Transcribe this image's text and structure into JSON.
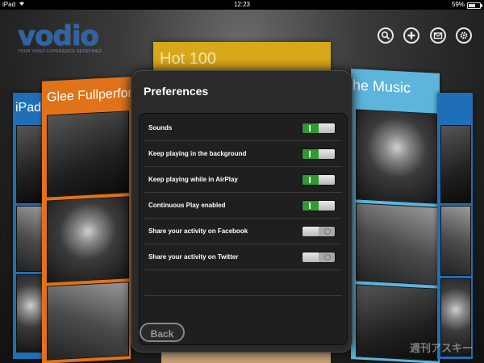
{
  "status_bar": {
    "device": "iPad",
    "time": "12:23",
    "battery": "59%",
    "battery_level": 0.59
  },
  "logo": {
    "name": "vodio",
    "tagline": "YOUR VIDEO EXPERIENCE REDEFINED"
  },
  "top_icons": [
    "search-icon",
    "add-icon",
    "mail-icon",
    "gear-icon"
  ],
  "panels": {
    "left_blue": "iPad A",
    "orange": "Glee Fullperform",
    "yellow": "Hot 100",
    "light_blue": "he Music"
  },
  "preferences": {
    "title": "Preferences",
    "items": [
      {
        "label": "Sounds",
        "on": true
      },
      {
        "label": "Keep playing in the background",
        "on": true
      },
      {
        "label": "Keep playing while in AirPlay",
        "on": true
      },
      {
        "label": "Continuous Play enabled",
        "on": true
      },
      {
        "label": "Share your activity on Facebook",
        "on": false
      },
      {
        "label": "Share your activity on Twitter",
        "on": false
      }
    ],
    "back_label": "Back"
  },
  "watermark": "週刊アスキー",
  "colors": {
    "accent_green": "#2f9a32",
    "logo_blue": "#2f63a8",
    "orange": "#e0731a",
    "light_blue": "#5db5dc",
    "yellow": "#d9a81a"
  }
}
